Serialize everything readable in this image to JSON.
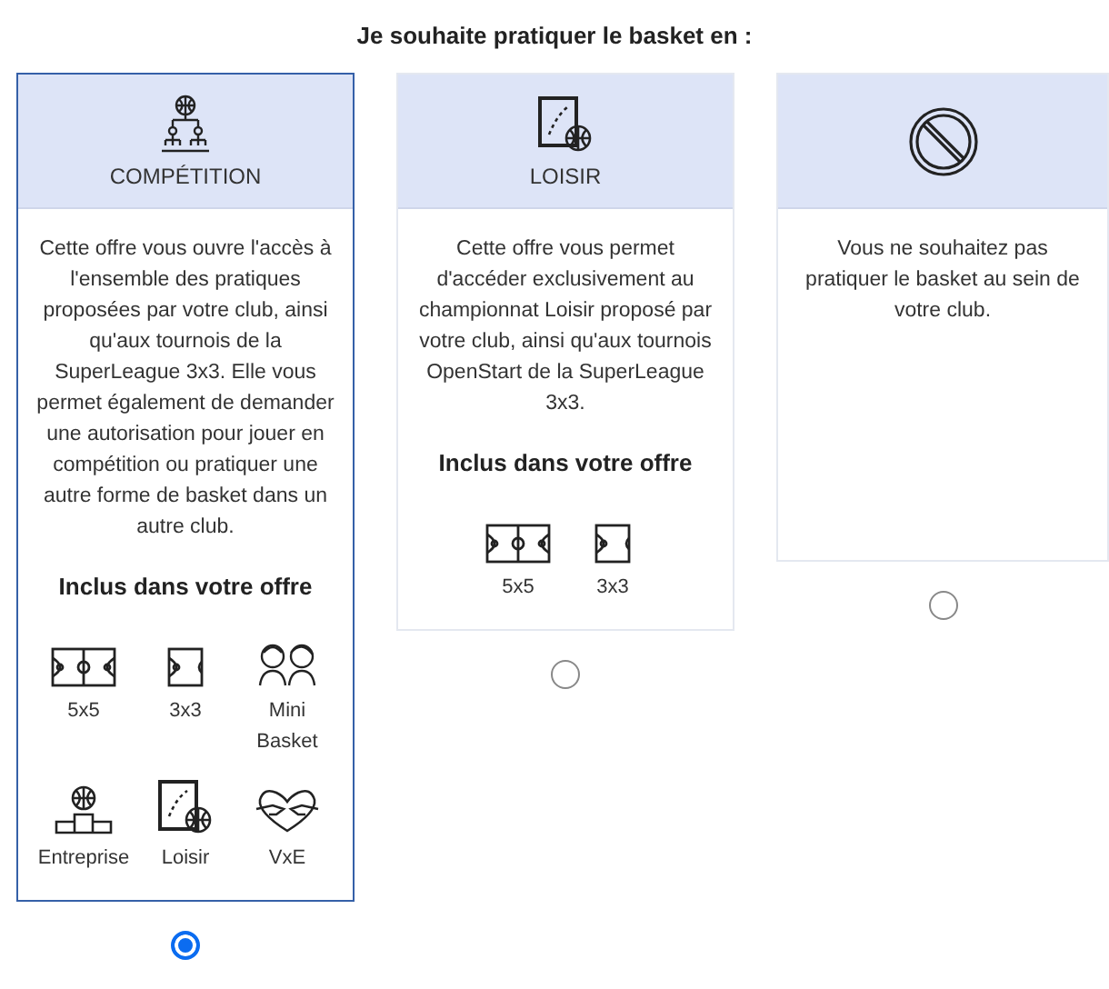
{
  "title": "Je souhaite pratiquer le basket en :",
  "offers": [
    {
      "kind": "competition",
      "label": "COMPÉTITION",
      "selected": true,
      "description": "Cette offre vous ouvre l'accès à l'ensemble des pratiques proposées par votre club, ainsi qu'aux tournois de la SuperLeague 3x3. Elle vous permet également de demander une autorisation pour jouer en compétition ou pratiquer une autre forme de basket dans un autre club.",
      "included_title": "Inclus dans votre offre",
      "included": [
        {
          "kind": "full_court",
          "label": "5x5"
        },
        {
          "kind": "half_court",
          "label": "3x3"
        },
        {
          "kind": "kids",
          "label": "Mini Basket"
        },
        {
          "kind": "podium",
          "label": "Entreprise"
        },
        {
          "kind": "board",
          "label": "Loisir"
        },
        {
          "kind": "heart",
          "label": "VxE"
        }
      ]
    },
    {
      "kind": "leisure",
      "label": "LOISIR",
      "selected": false,
      "description": "Cette offre vous permet d'accéder exclusivement au championnat Loisir proposé par votre club, ainsi qu'aux tournois OpenStart de la SuperLeague 3x3.",
      "included_title": "Inclus dans votre offre",
      "included": [
        {
          "kind": "full_court",
          "label": "5x5"
        },
        {
          "kind": "half_court",
          "label": "3x3"
        }
      ]
    },
    {
      "kind": "none",
      "selected": false,
      "description": "Vous ne souhaitez pas pratiquer le basket au sein de votre club."
    }
  ]
}
